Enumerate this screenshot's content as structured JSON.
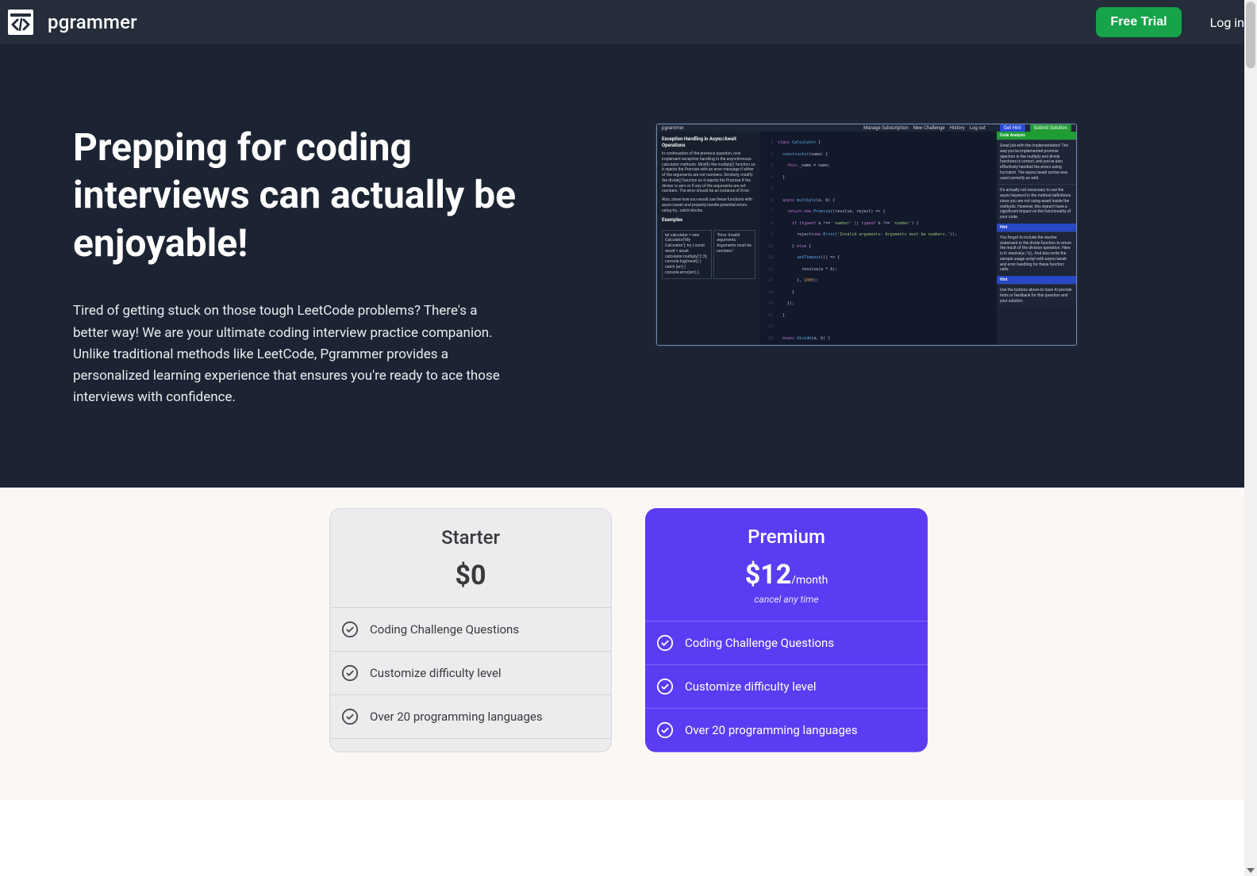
{
  "nav": {
    "brand": "pgrammer",
    "free_trial": "Free Trial",
    "login": "Log in"
  },
  "hero": {
    "title": "Prepping for coding interviews can actually be enjoyable!",
    "subtitle": "Tired of getting stuck on those tough LeetCode problems? There's a better way! We are your ultimate coding interview practice companion. Unlike traditional methods like LeetCode, Pgrammer provides a personalized learning experience that ensures you're ready to ace those interviews with confidence."
  },
  "screenshot": {
    "brand": "pgrammer",
    "menu": {
      "m1": "Manage Subscription",
      "m2": "New Challenge",
      "m3": "History",
      "m4": "Log out"
    },
    "get_hint": "Get Hint",
    "submit": "Submit Solution",
    "prompt_title": "Exception Handling in Async/Await Operations",
    "prompt_body": "In continuation of the previous question, now implement exception handling in the asynchronous calculator methods. Modify the multiply() function so it rejects the Promise with an error message if either of the arguments are not numbers. Similarly, modify the divide() function so it rejects the Promise if the divisor is zero or if any of the arguments are not numbers. The error should be an instance of Error.",
    "prompt_body2": "Also, show how you would use these functions with async/await and properly handle potential errors using try...catch blocks.",
    "examples_label": "Examples",
    "ex1": "let calculator = new Calculator('My Calculator');\ntry {\n  const result = await calculator.multiply('2',3);\n  console.log(result);\n} catch (err) {\n  console.error(err);\n}",
    "ex1_out": "\"Error: Invalid arguments: Arguments must be numbers.\"",
    "panel_title": "Code Analysis",
    "panel_body1": "Great job with the implementation! The way you've implemented promise rejection in the multiply and divide functions is correct, and you've also effectively handled the errors using try/catch. The async/await syntax was used correctly as well.",
    "panel_body2": "It's actually not necessary to use the async keyword in the method definitions since you are not using await inside the methods. However, this doesn't have a significant impact on the functionality of your code.",
    "hint_label": "Hint",
    "hint_body1": "You forgot to include the resolve statement in the divide function to return the result of the division operation. Here is it: resolve(a / b);. And also write the sample usage script with async/await and error handling for these function calls.",
    "hint_body2": "Use the buttons above to have AI provide hints or feedback for this question and your solution"
  },
  "plans": {
    "starter": {
      "name": "Starter",
      "price": "$0",
      "features": [
        "Coding Challenge Questions",
        "Customize difficulty level",
        "Over 20 programming languages"
      ]
    },
    "premium": {
      "name": "Premium",
      "price": "$12",
      "per": "/month",
      "note": "cancel any time",
      "features": [
        "Coding Challenge Questions",
        "Customize difficulty level",
        "Over 20 programming languages"
      ]
    }
  }
}
